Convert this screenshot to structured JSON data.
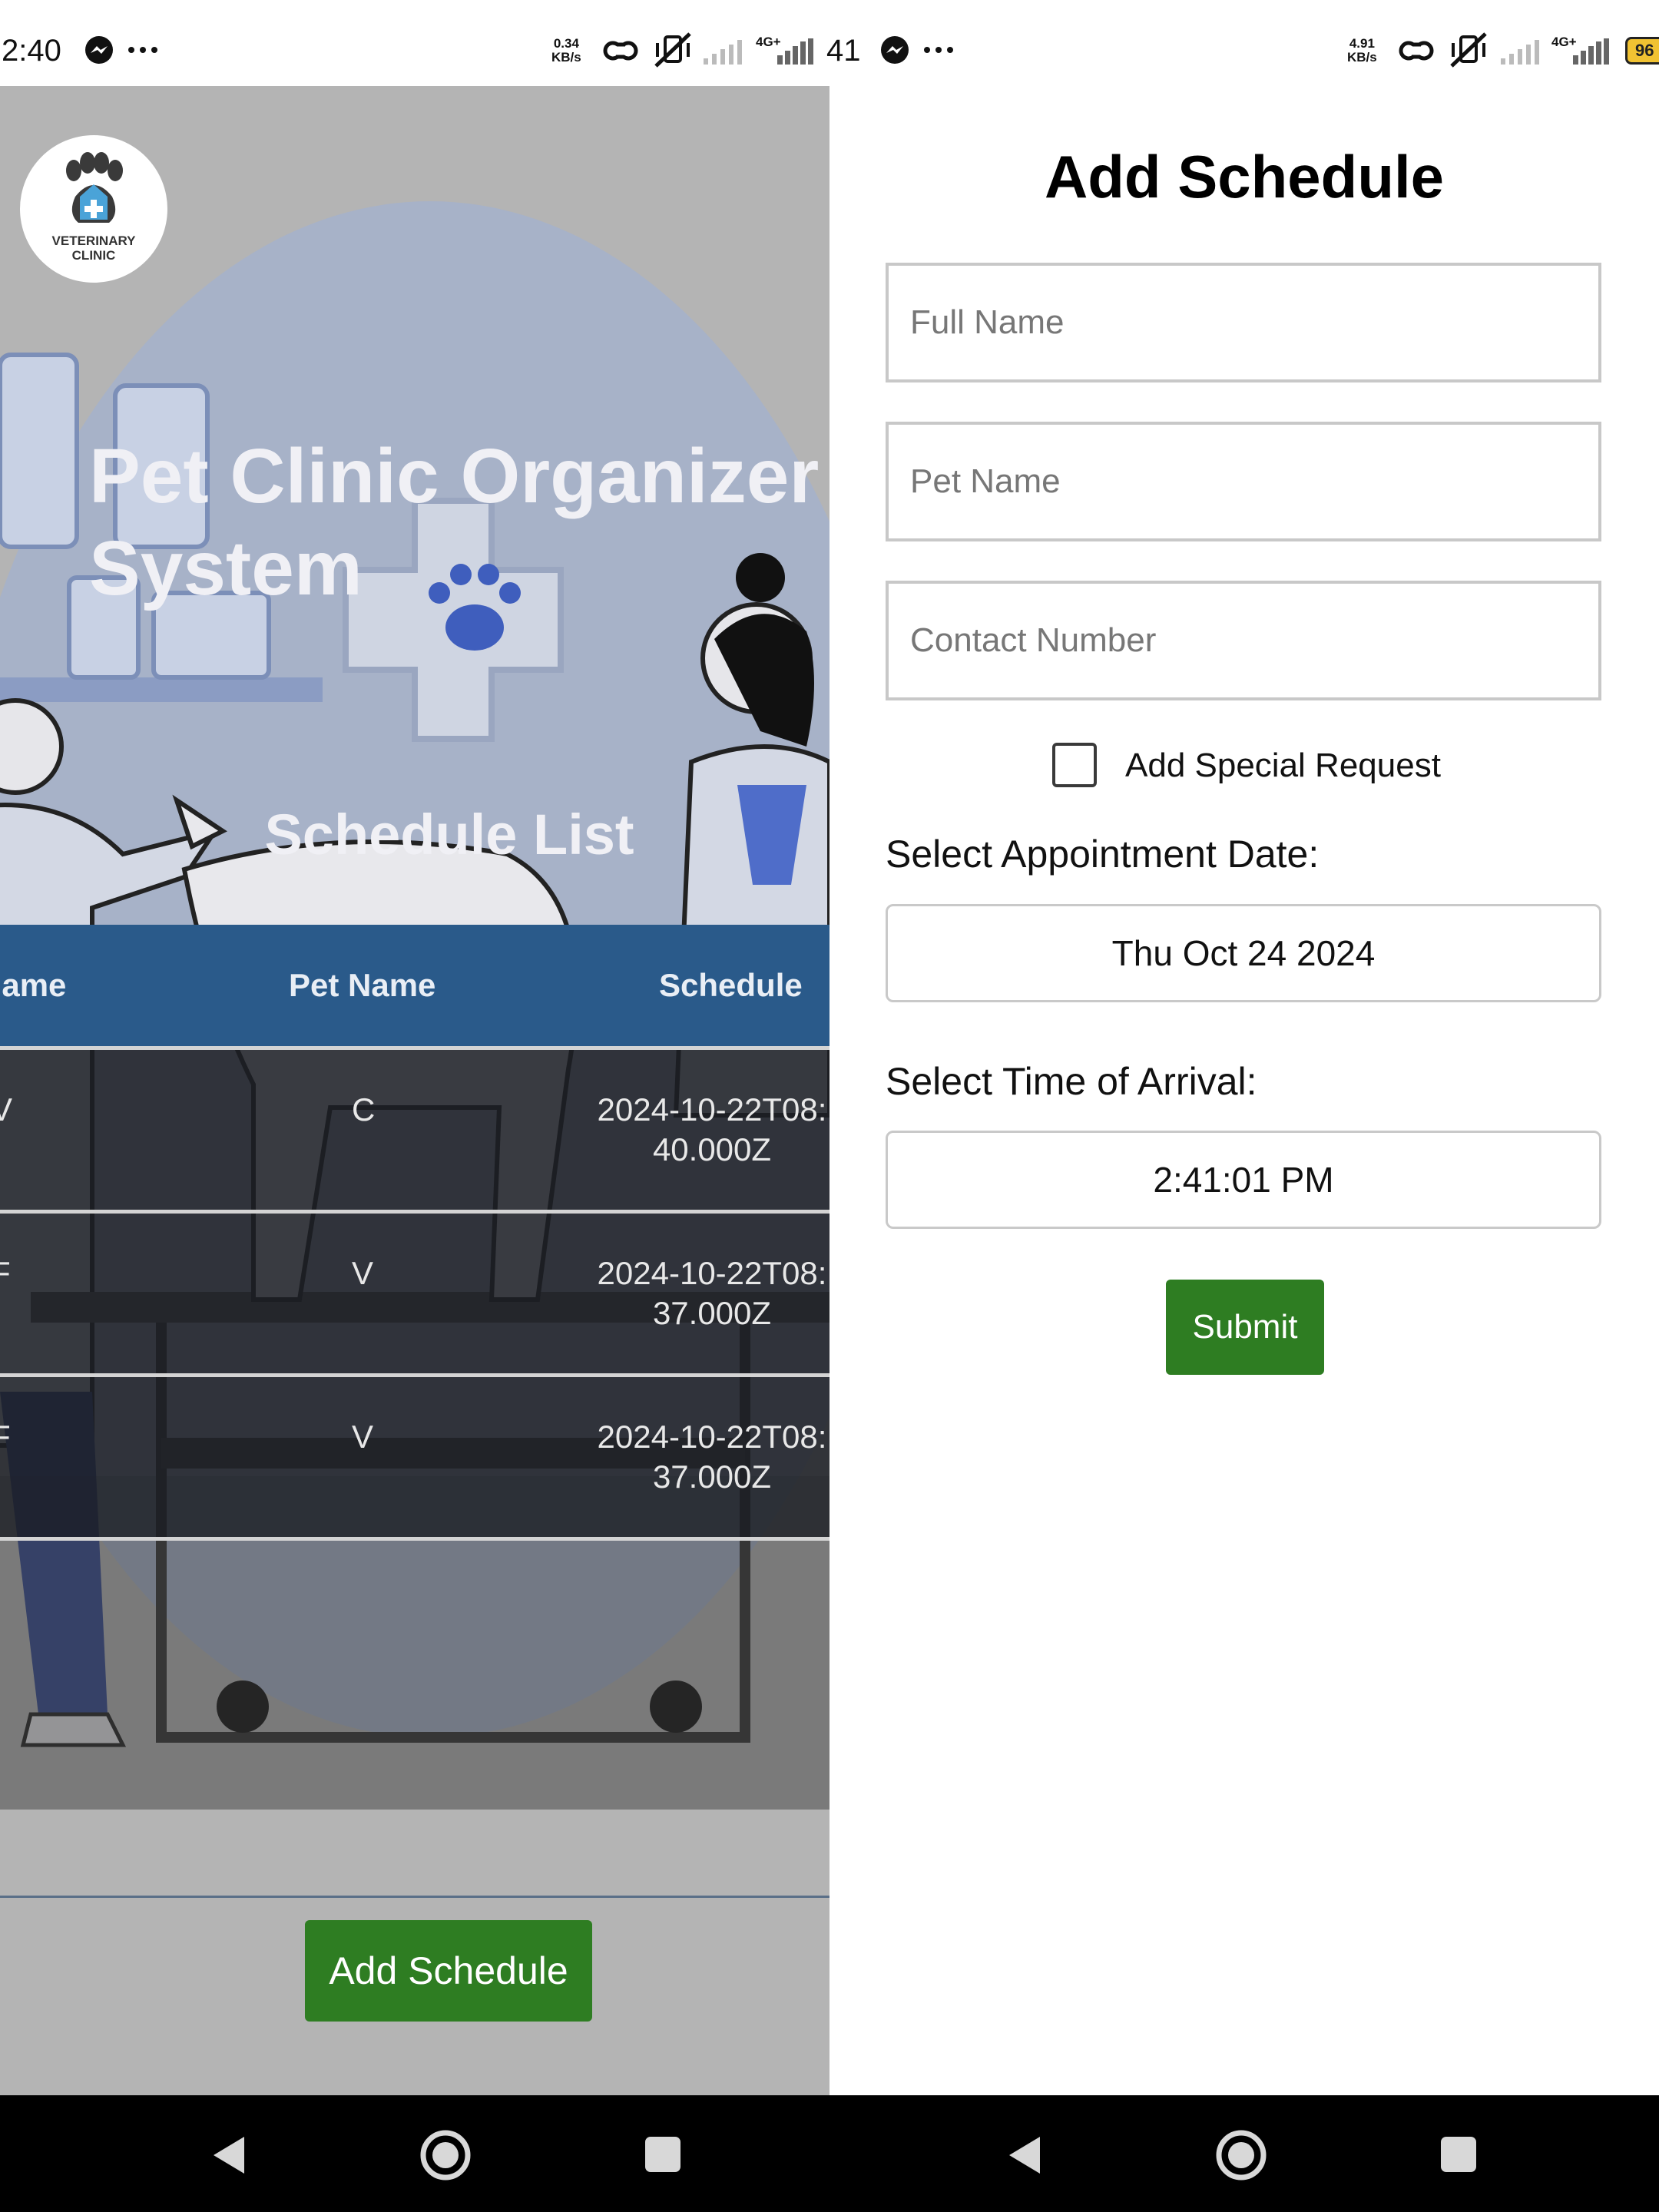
{
  "status_left": {
    "time": "2:40",
    "net_speed_value": "0.34",
    "net_speed_unit": "KB/s",
    "network_type": "4G+",
    "battery": "41"
  },
  "status_right": {
    "net_speed_value": "4.91",
    "net_speed_unit": "KB/s",
    "network_type": "4G+",
    "battery": "96"
  },
  "schedule_screen": {
    "logo_text_line1": "VETERINARY",
    "logo_text_line2": "CLINIC",
    "app_title": "Pet Clinic Organizer System",
    "list_title": "Schedule List",
    "columns": [
      "Name",
      "Pet Name",
      "Schedule"
    ],
    "rows": [
      {
        "name": "V",
        "pet": "C",
        "schedule_line1": "2024-10-22T08:",
        "schedule_line2": "40.000Z"
      },
      {
        "name": "F",
        "pet": "V",
        "schedule_line1": "2024-10-22T08:",
        "schedule_line2": "37.000Z"
      },
      {
        "name": "F",
        "pet": "V",
        "schedule_line1": "2024-10-22T08:",
        "schedule_line2": "37.000Z"
      }
    ],
    "add_button": "Add Schedule"
  },
  "form_screen": {
    "title": "Add Schedule",
    "full_name_placeholder": "Full Name",
    "pet_name_placeholder": "Pet Name",
    "contact_placeholder": "Contact Number",
    "special_request_label": "Add Special Request",
    "special_request_checked": false,
    "date_label": "Select Appointment Date:",
    "date_value": "Thu Oct 24 2024",
    "time_label": "Select Time of Arrival:",
    "time_value": "2:41:01 PM",
    "submit_label": "Submit"
  },
  "colors": {
    "table_header": "#2a5a8a",
    "button_green": "#2e7d22",
    "battery_yellow": "#f1c232"
  },
  "icons": [
    "messenger-icon",
    "more-icon",
    "link-icon",
    "mute-vibrate-icon",
    "signal-icon",
    "battery-icon",
    "back-icon",
    "home-icon",
    "recents-icon",
    "paw-cross-logo-icon"
  ]
}
